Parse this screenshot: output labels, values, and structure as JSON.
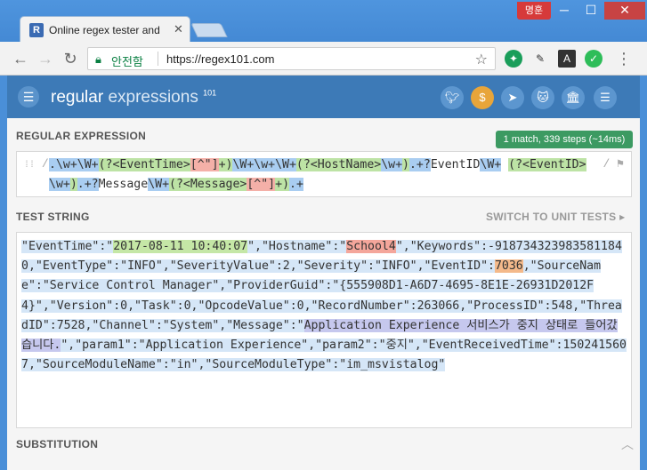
{
  "browser": {
    "tab_title": "Online regex tester and",
    "tab_favicon": "R",
    "user_badge": "명훈",
    "secure_label": "안전함",
    "url": "https://regex101.com"
  },
  "app": {
    "brand_main": "regular",
    "brand_sub": "expressions",
    "brand_num": "101"
  },
  "regex": {
    "section_label": "REGULAR EXPRESSION",
    "match_info": "1 match, 339 steps (~14ms)",
    "delimiter_open": "/",
    "delimiter_close": "/",
    "tokens": [
      {
        "t": ".\\w+\\W+",
        "c": "blue"
      },
      {
        "t": "(?<EventTime>",
        "c": "green"
      },
      {
        "t": "[^\"]",
        "c": "red"
      },
      {
        "t": "+)",
        "c": "green"
      },
      {
        "t": "\\W+\\w+\\W+",
        "c": "blue"
      },
      {
        "t": "(?<HostName>",
        "c": "green"
      },
      {
        "t": "\\w+",
        "c": "blue"
      },
      {
        "t": ")",
        "c": "green"
      },
      {
        "t": ".+?",
        "c": "blue"
      },
      {
        "t": "EventID",
        "c": "plain"
      },
      {
        "t": "\\W+",
        "c": "blue"
      },
      {
        "t": " ",
        "c": "plain"
      },
      {
        "t": "(?<EventID>",
        "c": "green"
      },
      {
        "t": "\\w+",
        "c": "blue"
      },
      {
        "t": ")",
        "c": "green"
      },
      {
        "t": ".+?",
        "c": "blue"
      },
      {
        "t": "Message",
        "c": "plain"
      },
      {
        "t": "\\W+",
        "c": "blue"
      },
      {
        "t": "(?<Message>",
        "c": "green"
      },
      {
        "t": "[^\"]",
        "c": "red"
      },
      {
        "t": "+)",
        "c": "green"
      },
      {
        "t": ".+",
        "c": "blue"
      }
    ]
  },
  "test": {
    "section_label": "TEST STRING",
    "unit_tests_link": "SWITCH TO UNIT TESTS ▸",
    "segments": [
      {
        "t": "\"EventTime\":\"",
        "c": "full"
      },
      {
        "t": "2017-08-11 10:40:07",
        "c": "time"
      },
      {
        "t": "\",\"Hostname\":\"",
        "c": "full"
      },
      {
        "t": "School4",
        "c": "host"
      },
      {
        "t": "\",\"Keywords\":-9187343239835811840,\"EventType\":\"INFO\",\"SeverityValue\":2,\"Severity\":\"INFO\",\"EventID\":",
        "c": "full"
      },
      {
        "t": "7036",
        "c": "eid"
      },
      {
        "t": ",\"SourceName\":\"Service Control Manager\",\"ProviderGuid\":\"{555908D1-A6D7-4695-8E1E-26931D2012F4}\",\"Version\":0,\"Task\":0,\"OpcodeValue\":0,\"RecordNumber\":263066,\"ProcessID\":548,\"ThreadID\":7528,\"Channel\":\"System\",\"Message\":\"",
        "c": "full"
      },
      {
        "t": "Application Experience 서비스가 중지 상태로 들어갔습니다.",
        "c": "msg"
      },
      {
        "t": "\",\"param1\":\"Application Experience\",\"param2\":\"중지\",\"EventReceivedTime\":1502415607,\"SourceModuleName\":\"in\",\"SourceModuleType\":\"im_msvistalog\"",
        "c": "full"
      }
    ]
  },
  "substitution": {
    "section_label": "SUBSTITUTION"
  }
}
